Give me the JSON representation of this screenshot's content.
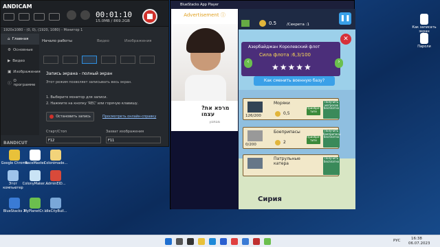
{
  "desktop": {
    "left_icons": [
      {
        "label": "Google Chrome",
        "color": "#e8c13a"
      },
      {
        "label": "RaceMaster",
        "color": "#ffffff"
      },
      {
        "label": "Colonimade...",
        "color": "#f2d37a"
      },
      {
        "label": "Этот компьютер",
        "color": "#9ec3ea"
      },
      {
        "label": "ColonyMaker...",
        "color": "#c9e3f5"
      },
      {
        "label": "AdminElD...",
        "color": "#d94a3a"
      },
      {
        "label": "BlueStacks X",
        "color": "#3a7bd5"
      },
      {
        "label": "MyPlanetCr...",
        "color": "#6bbf4e"
      },
      {
        "label": "IdleCityBuil...",
        "color": "#7aa7d8"
      }
    ],
    "right_icons": [
      {
        "label": "Как записать экран",
        "color": "#ffffff"
      },
      {
        "label": "Пароли",
        "color": "#ffffff"
      }
    ]
  },
  "bandicam": {
    "title": "ANDICAM",
    "timer": "00:01:10",
    "size": "15.0MB / 869.2GB",
    "resolution": "1920x1080 - (0, 0), (1920, 1080) - Монитор 1",
    "sidebar": [
      "Главная",
      "Основные",
      "Видео",
      "Изображения",
      "О программе"
    ],
    "tabs": [
      "Начало работы",
      "Видео",
      "Изображения"
    ],
    "heading": "Запись экрана - полный экран",
    "desc": "Этот режим позволяет записывать весь экран.",
    "step1": "1. Выберите монитор для записи.",
    "step2": "2. Нажмите на кнопку 'REC' или горячую клавишу.",
    "stop_button": "Остановить запись",
    "help_link": "Просмотреть онлайн-справку",
    "hotkey_label": "Старт/Стоп",
    "hotkey_value": "F12",
    "capture_label": "Захват изображения",
    "capture_value": "F11",
    "brand": "BANDICUT"
  },
  "bluestacks": {
    "title": "BlueStacks App Player",
    "ad": {
      "label": "Advertisement",
      "question": "?מרפא את עצמו",
      "footer": "מבתכון"
    },
    "game": {
      "coins": "0.5",
      "secret": "/Секрета :1",
      "fleet_name": "Азербайджан Королевский флот",
      "fleet_power": "Сила флота :6,3/100",
      "stars": 5,
      "change_base": "Как сменить военную базу?",
      "rows": [
        {
          "label": "Моряки",
          "count": "126/200",
          "cost": "0,5",
          "buy": "Приобре- тите",
          "side": "Получить матросов бесплатно"
        },
        {
          "label": "Боеприпасы",
          "count": "0/200",
          "cost": "2",
          "buy": "Приобре- тите",
          "side": "Получить боеприпасы бесплатно"
        },
        {
          "label": "Патрульные катера",
          "count": "",
          "cost": "",
          "buy": "",
          "side": "Получить бесплатно"
        }
      ],
      "map_label": "Сирия"
    }
  },
  "taskbar": {
    "lang": "РУС",
    "time": "16:38",
    "date": "06.07.2023"
  }
}
